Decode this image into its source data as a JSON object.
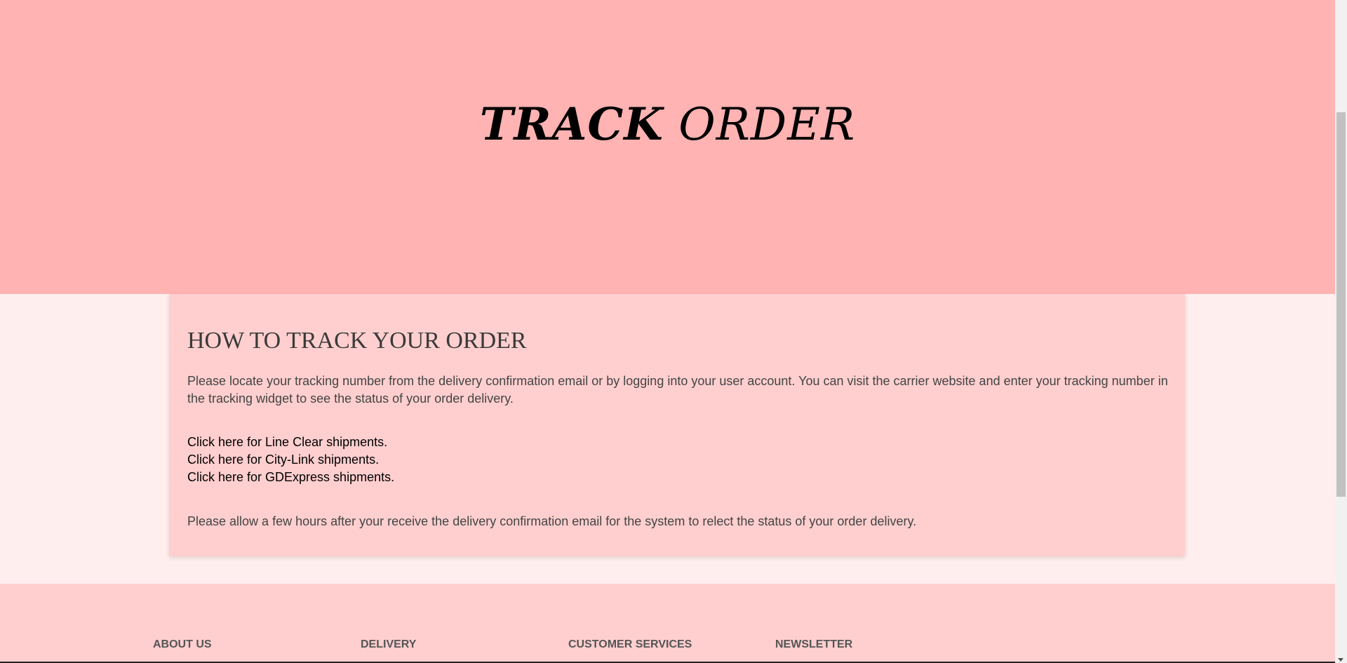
{
  "hero": {
    "title_bold": "TRACK",
    "title_light": "ORDER"
  },
  "card": {
    "heading": "HOW TO TRACK YOUR ORDER",
    "intro": "Please locate your tracking number from the delivery confirmation email or by logging into your user account. You can visit the carrier website and enter your tracking number in the tracking widget to see the status of your order delivery.",
    "links": [
      "Click here for Line Clear shipments.",
      "Click here for City-Link shipments.",
      "Click here for GDExpress shipments."
    ],
    "note": "Please allow a few hours after your receive the delivery confirmation email for the system to relect the status of your order delivery."
  },
  "footer": {
    "columns": [
      "ABOUT US",
      "DELIVERY",
      "CUSTOMER SERVICES",
      "NEWSLETTER"
    ]
  },
  "colors": {
    "hero_bg": "#ffb3b2",
    "card_bg": "#ffcfcf",
    "page_bg": "#ffeeed"
  }
}
